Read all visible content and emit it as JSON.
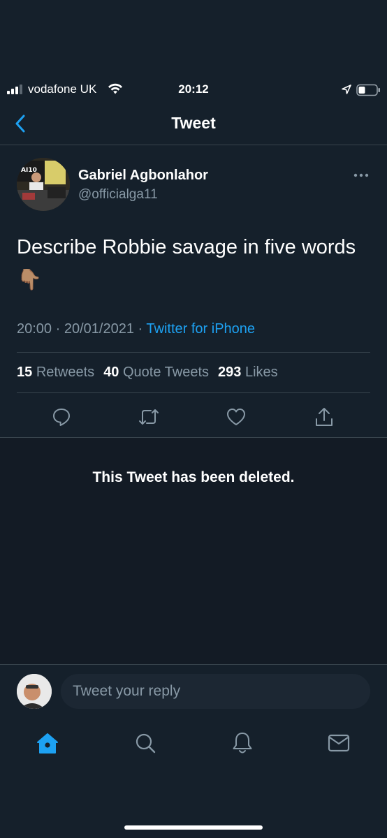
{
  "status_bar": {
    "carrier": "vodafone UK",
    "time": "20:12"
  },
  "nav": {
    "title": "Tweet",
    "back_icon": "chevron-left-icon"
  },
  "tweet": {
    "author": {
      "display_name": "Gabriel Agbonlahor",
      "handle": "@officialga11"
    },
    "text": "Describe Robbie savage in five words",
    "emoji": "👇🏽",
    "time": "20:00",
    "date": "20/01/2021",
    "separator": "·",
    "source": "Twitter for iPhone",
    "stats": {
      "retweets_count": "15",
      "retweets_label": "Retweets",
      "quotes_count": "40",
      "quotes_label": "Quote Tweets",
      "likes_count": "293",
      "likes_label": "Likes"
    },
    "actions": [
      "reply-icon",
      "retweet-icon",
      "like-icon",
      "share-icon"
    ]
  },
  "deleted_notice": "This Tweet has been deleted.",
  "reply": {
    "placeholder": "Tweet your reply"
  },
  "tab_bar": {
    "tabs": [
      "home-icon",
      "search-icon",
      "notifications-icon",
      "messages-icon"
    ],
    "active": "home-icon"
  },
  "colors": {
    "background": "#15202b",
    "accent": "#1da1f2",
    "secondary_text": "#8899a6",
    "border": "#38444d"
  }
}
